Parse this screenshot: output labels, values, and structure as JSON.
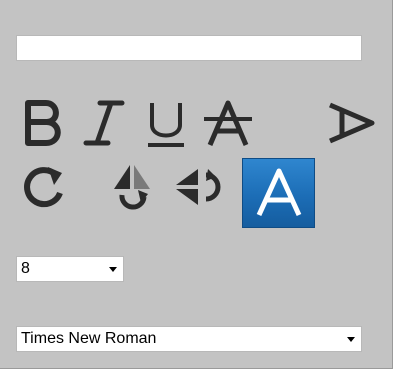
{
  "text_input": {
    "value": "",
    "placeholder": ""
  },
  "toolbar_icons": [
    {
      "name": "bold-icon"
    },
    {
      "name": "italic-icon"
    },
    {
      "name": "underline-icon"
    },
    {
      "name": "strikethrough-icon"
    },
    {
      "name": "rotated-text-icon"
    },
    {
      "name": "rotate-icon"
    },
    {
      "name": "flip-vertical-icon"
    },
    {
      "name": "flip-horizontal-icon"
    },
    {
      "name": "text-fill-icon"
    }
  ],
  "colors": {
    "panel_bg": "#c3c3c3",
    "icon_dark": "#2b2b2b",
    "icon_mid": "#5a5a5a",
    "active_blue": "#1c6db6"
  },
  "font_size": {
    "value": "8"
  },
  "font_family": {
    "value": "Times New Roman"
  }
}
